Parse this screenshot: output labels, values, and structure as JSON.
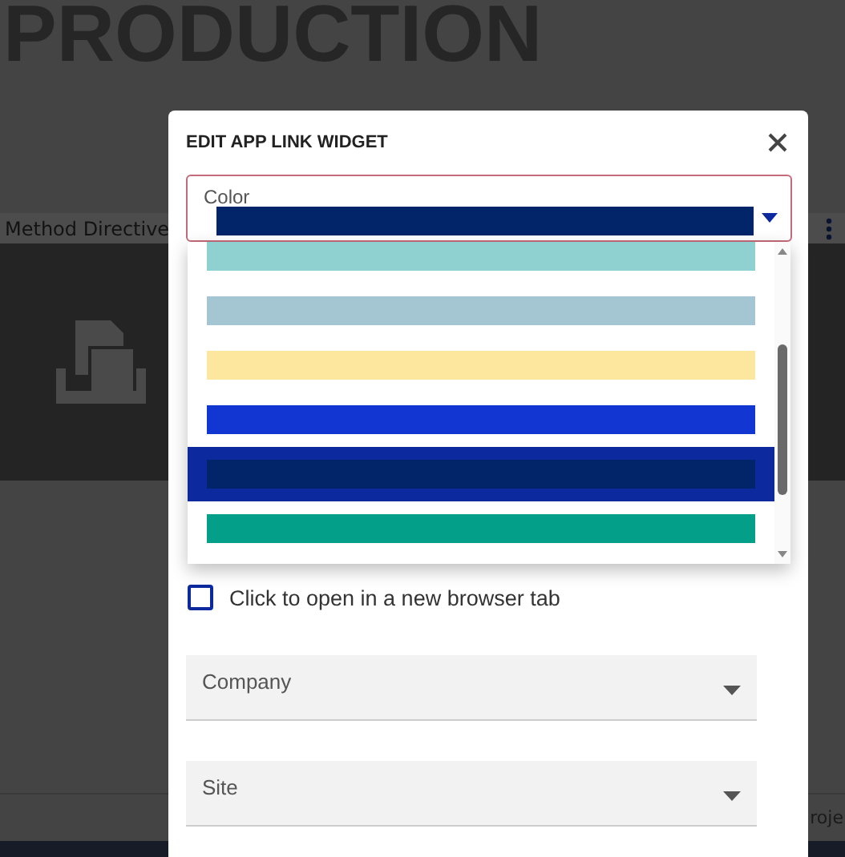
{
  "page": {
    "heading": "PRODUCTION",
    "tab_label": "Method Directive",
    "footer_text": "roje"
  },
  "dialog": {
    "title": "EDIT APP LINK WIDGET",
    "color_field": {
      "label": "Color",
      "expanded": true
    },
    "color_options": [
      {
        "color": "#8fd1d1",
        "selected": false
      },
      {
        "color": "#a4c6d2",
        "selected": false
      },
      {
        "color": "#fde79e",
        "selected": false
      },
      {
        "color": "#1236d1",
        "selected": false
      },
      {
        "color": "#022468",
        "selected": true
      },
      {
        "color": "#039f89",
        "selected": false
      }
    ],
    "new_tab_checkbox": {
      "label": "Click to open in a new browser tab",
      "checked": false
    },
    "fields": [
      {
        "placeholder": "Company"
      },
      {
        "placeholder": "Site"
      }
    ]
  }
}
